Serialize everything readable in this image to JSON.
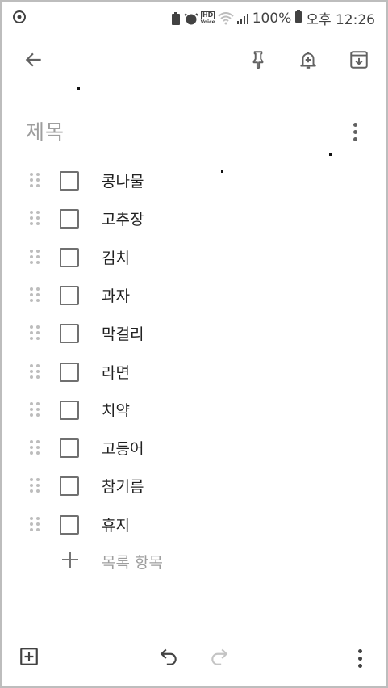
{
  "status_bar": {
    "battery_percent": "100%",
    "time": "오후 12:26",
    "volte_label": "HD",
    "voice_label": "Voice"
  },
  "toolbar": {
    "icons": [
      "back-arrow-icon",
      "pin-icon",
      "reminder-bell-icon",
      "archive-icon"
    ]
  },
  "note": {
    "title_placeholder": "제목",
    "items": [
      {
        "text": "콩나물",
        "checked": false
      },
      {
        "text": "고추장",
        "checked": false
      },
      {
        "text": "김치",
        "checked": false
      },
      {
        "text": "과자",
        "checked": false
      },
      {
        "text": "막걸리",
        "checked": false
      },
      {
        "text": "라면",
        "checked": false
      },
      {
        "text": "치약",
        "checked": false
      },
      {
        "text": "고등어",
        "checked": false
      },
      {
        "text": "참기름",
        "checked": false
      },
      {
        "text": "휴지",
        "checked": false
      }
    ],
    "add_item_label": "목록 항목"
  },
  "bottom_bar": {
    "icons": [
      "add-box-icon",
      "undo-icon",
      "redo-icon",
      "more-vert-icon"
    ]
  },
  "colors": {
    "icon": "#616161",
    "text": "#212121",
    "placeholder": "#9e9e9e",
    "checkbox": "#707070",
    "drag_handle": "#bdbdbd"
  }
}
